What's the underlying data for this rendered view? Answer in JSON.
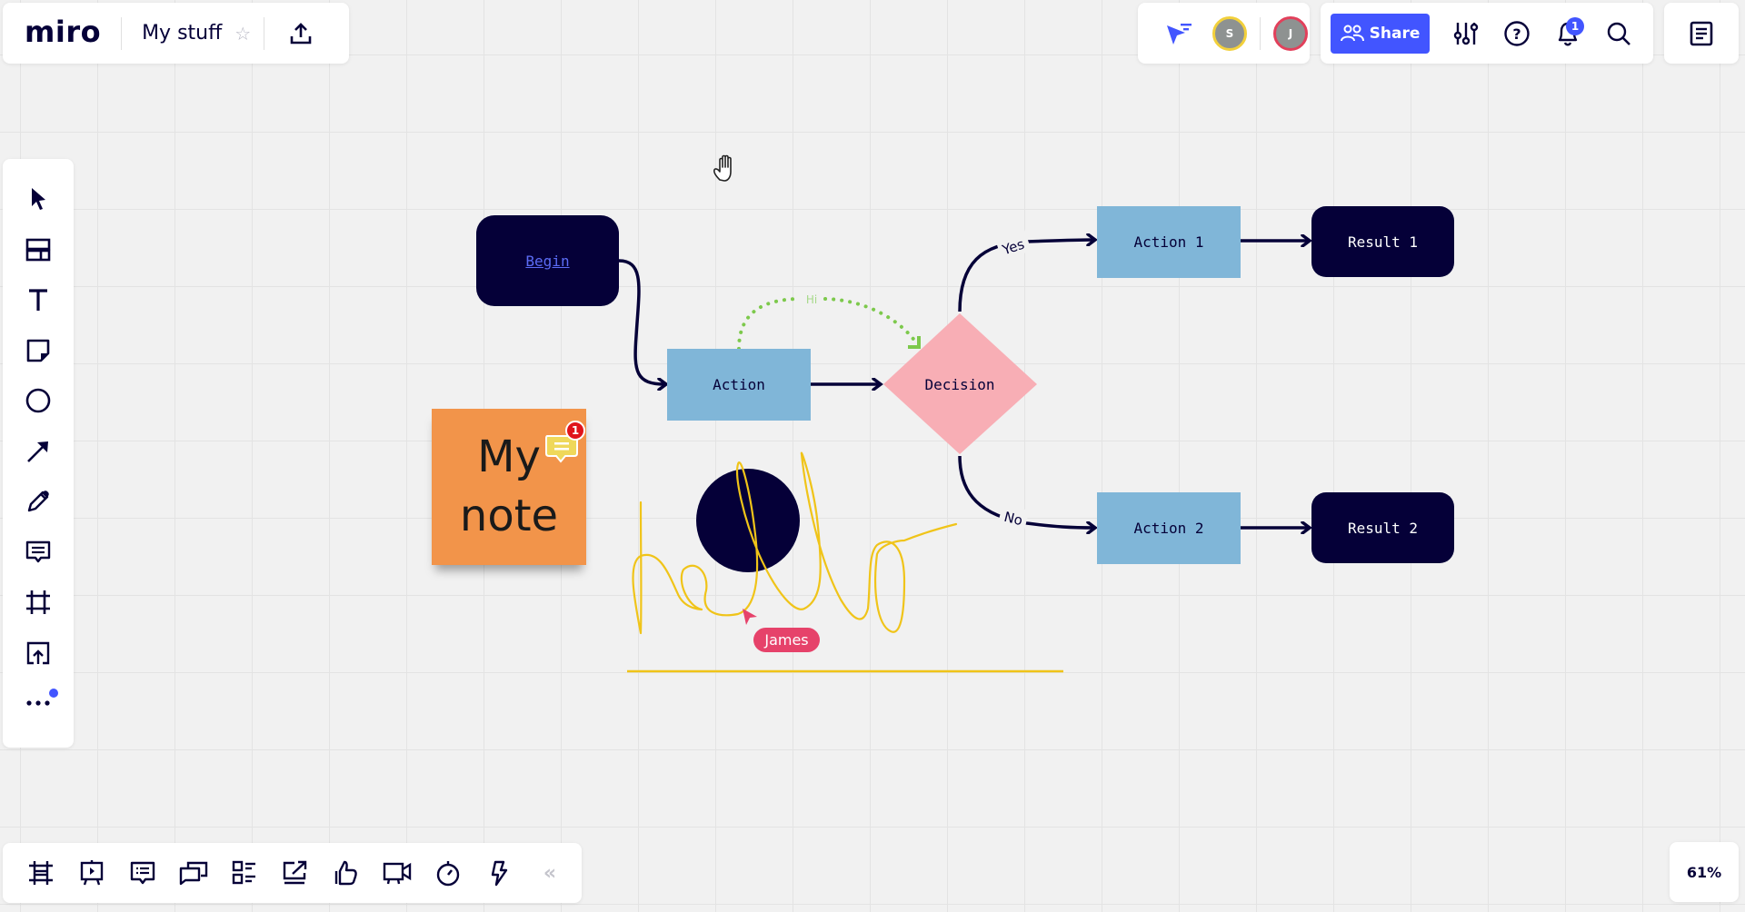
{
  "app": {
    "logo": "miro",
    "board_title": "My stuff",
    "star_icon": "star-icon",
    "export_icon": "upload-icon"
  },
  "collaborators": {
    "filter_icon": "cursor-filter-icon",
    "users": [
      {
        "initial": "S",
        "ring_color": "#f2d03b"
      },
      {
        "initial": "J",
        "ring_color": "#e2405b"
      }
    ]
  },
  "toolbar_right": {
    "share_label": "Share",
    "share_color": "#4255ff",
    "icons": [
      "settings-sliders-icon",
      "help-icon",
      "bell-icon",
      "search-icon"
    ],
    "notification_count": "1",
    "notes_icon": "notes-icon"
  },
  "left_toolbar": {
    "tools": [
      {
        "name": "select",
        "icon": "cursor-arrow-icon"
      },
      {
        "name": "templates",
        "icon": "templates-icon"
      },
      {
        "name": "text",
        "icon": "text-icon"
      },
      {
        "name": "sticky-note",
        "icon": "sticky-note-icon"
      },
      {
        "name": "shapes",
        "icon": "circle-shape-icon"
      },
      {
        "name": "connection-line",
        "icon": "arrow-line-icon"
      },
      {
        "name": "pen",
        "icon": "pen-icon"
      },
      {
        "name": "comment",
        "icon": "comment-icon"
      },
      {
        "name": "frame",
        "icon": "frame-icon"
      },
      {
        "name": "upload",
        "icon": "upload-box-icon"
      },
      {
        "name": "more",
        "icon": "more-dots-icon"
      }
    ]
  },
  "bottom_toolbar": {
    "tools": [
      {
        "name": "frames",
        "icon": "frames-icon"
      },
      {
        "name": "presentation",
        "icon": "presentation-icon"
      },
      {
        "name": "comments",
        "icon": "comments-list-icon"
      },
      {
        "name": "chat",
        "icon": "chat-icon"
      },
      {
        "name": "cards",
        "icon": "card-list-icon"
      },
      {
        "name": "screen-share",
        "icon": "screen-share-icon"
      },
      {
        "name": "voting",
        "icon": "thumbs-up-icon"
      },
      {
        "name": "video",
        "icon": "video-icon"
      },
      {
        "name": "timer",
        "icon": "timer-icon"
      },
      {
        "name": "apps",
        "icon": "lightning-icon"
      }
    ],
    "collapse_label": "«"
  },
  "zoom": {
    "level": "61%"
  },
  "canvas": {
    "nodes": {
      "begin": "Begin",
      "action": "Action",
      "decision": "Decision",
      "action1": "Action 1",
      "action2": "Action 2",
      "result1": "Result 1",
      "result2": "Result 2"
    },
    "edge_labels": {
      "yes": "Yes",
      "no": "No",
      "hi": "Hi"
    },
    "sticky_note": {
      "text": "My note",
      "color": "#f2944a",
      "comment_count": "1"
    },
    "handwriting": "hello",
    "collaborator_cursor": {
      "name": "James",
      "color": "#e6426a"
    },
    "colors": {
      "dark_node": "#050038",
      "blue_node": "#80b6d8",
      "decision": "#f8aeb5",
      "dotted_connector": "#7dc94c",
      "ink": "#f0c419"
    }
  }
}
